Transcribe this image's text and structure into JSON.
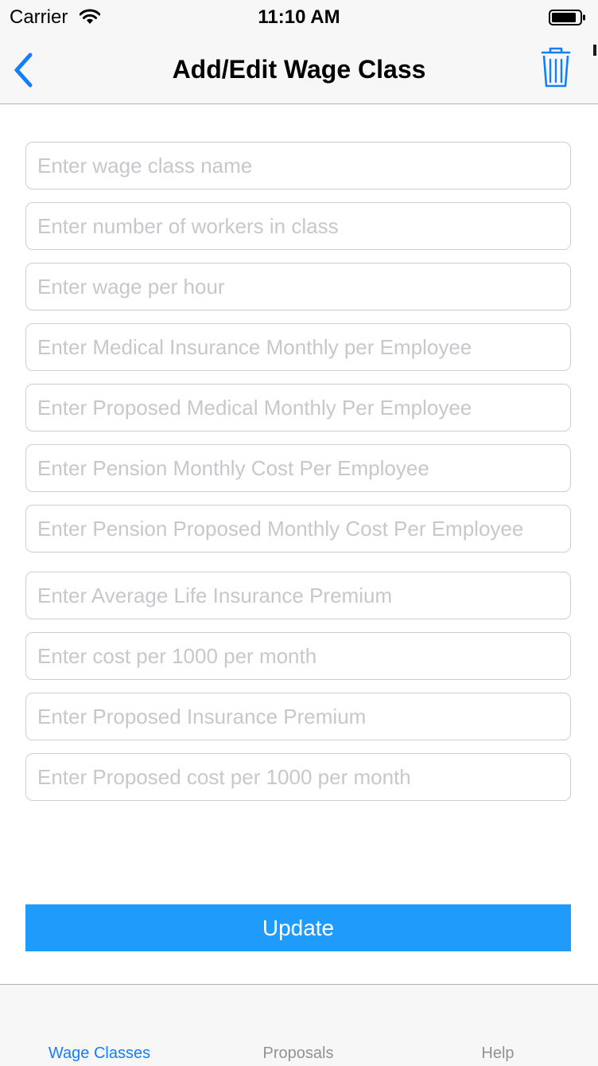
{
  "status_bar": {
    "carrier": "Carrier",
    "time": "11:10 AM",
    "wifi_icon": "wifi-icon",
    "battery_icon": "battery-icon"
  },
  "nav": {
    "title": "Add/Edit Wage Class",
    "back_icon": "chevron-left-icon",
    "trash_icon": "trash-icon",
    "accent_color": "#157efb"
  },
  "form": {
    "fields": [
      {
        "placeholder": "Enter wage class name",
        "value": ""
      },
      {
        "placeholder": "Enter number of workers in class",
        "value": ""
      },
      {
        "placeholder": "Enter wage per hour",
        "value": ""
      },
      {
        "placeholder": "Enter Medical Insurance Monthly per Employee",
        "value": ""
      },
      {
        "placeholder": "Enter Proposed Medical Monthly Per Employee",
        "value": ""
      },
      {
        "placeholder": "Enter Pension Monthly Cost Per Employee",
        "value": ""
      },
      {
        "placeholder": "Enter Pension Proposed Monthly Cost Per Employee",
        "value": ""
      },
      {
        "placeholder": "Enter Average Life Insurance Premium",
        "value": ""
      },
      {
        "placeholder": "Enter cost per 1000 per month",
        "value": ""
      },
      {
        "placeholder": "Enter Proposed Insurance Premium",
        "value": ""
      },
      {
        "placeholder": "Enter Proposed cost per 1000 per month",
        "value": ""
      }
    ],
    "update_label": "Update",
    "update_color": "#1e9bfb"
  },
  "tab_bar": {
    "tabs": [
      {
        "label": "Wage Classes",
        "active": true
      },
      {
        "label": "Proposals",
        "active": false
      },
      {
        "label": "Help",
        "active": false
      }
    ],
    "active_color": "#157efb",
    "inactive_color": "#929292"
  }
}
